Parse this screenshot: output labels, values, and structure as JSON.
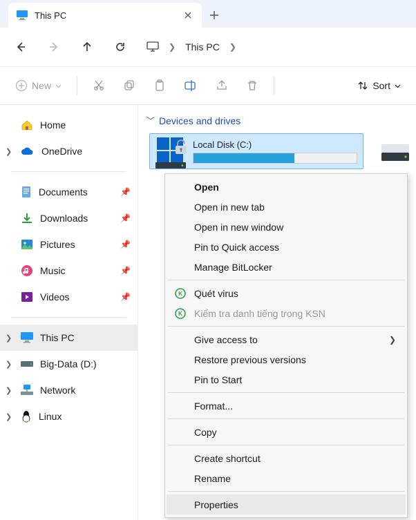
{
  "tab": {
    "title": "This PC"
  },
  "breadcrumb": {
    "label": "This PC"
  },
  "toolbar": {
    "new_label": "New",
    "sort_label": "Sort"
  },
  "sidebar": {
    "items": [
      {
        "label": "Home"
      },
      {
        "label": "OneDrive"
      },
      {
        "label": "Documents"
      },
      {
        "label": "Downloads"
      },
      {
        "label": "Pictures"
      },
      {
        "label": "Music"
      },
      {
        "label": "Videos"
      },
      {
        "label": "This PC"
      },
      {
        "label": "Big-Data (D:)"
      },
      {
        "label": "Network"
      },
      {
        "label": "Linux"
      }
    ]
  },
  "section": {
    "title": "Devices and drives"
  },
  "drives": [
    {
      "name": "Local Disk (C:)",
      "fill_pct": 62
    }
  ],
  "context_menu": {
    "items": [
      {
        "label": "Open",
        "bold": true
      },
      {
        "label": "Open in new tab"
      },
      {
        "label": "Open in new window"
      },
      {
        "label": "Pin to Quick access"
      },
      {
        "label": "Manage BitLocker"
      },
      {
        "sep": true
      },
      {
        "label": "Quét virus",
        "icon": "kaspersky"
      },
      {
        "label": "Kiểm tra danh tiếng trong KSN",
        "icon": "kaspersky",
        "disabled": true
      },
      {
        "sep": true
      },
      {
        "label": "Give access to",
        "submenu": true
      },
      {
        "label": "Restore previous versions"
      },
      {
        "label": "Pin to Start"
      },
      {
        "sep": true
      },
      {
        "label": "Format..."
      },
      {
        "sep": true
      },
      {
        "label": "Copy"
      },
      {
        "sep": true
      },
      {
        "label": "Create shortcut"
      },
      {
        "label": "Rename"
      },
      {
        "sep": true
      },
      {
        "label": "Properties",
        "hover": true
      }
    ]
  }
}
